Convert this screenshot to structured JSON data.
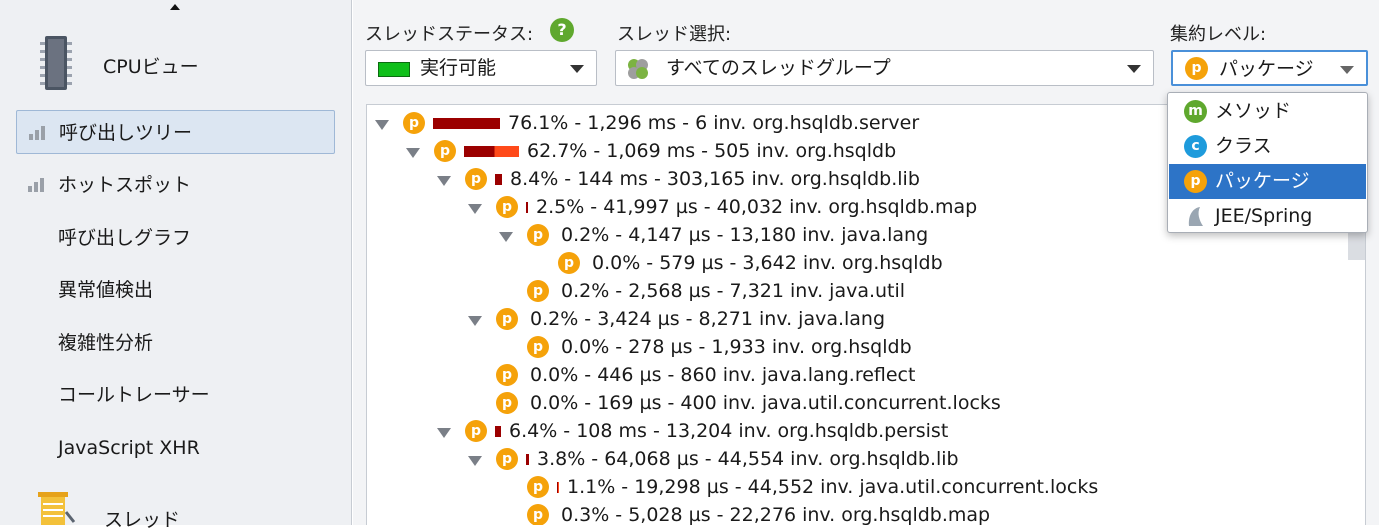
{
  "sidebar": {
    "cpu_view": "CPUビュー",
    "items": [
      {
        "label": "呼び出しツリー"
      },
      {
        "label": "ホットスポット"
      },
      {
        "label": "呼び出しグラフ"
      },
      {
        "label": "異常値検出"
      },
      {
        "label": "複雑性分析"
      },
      {
        "label": "コールトレーサー"
      },
      {
        "label": "JavaScript XHR"
      }
    ],
    "threads": "スレッド"
  },
  "toolbar": {
    "thread_status_label": "スレッドステータス:",
    "thread_status_value": "実行可能",
    "thread_select_label": "スレッド選択:",
    "thread_select_value": "すべてのスレッドグループ",
    "aggregation_label": "集約レベル:",
    "aggregation_value": "パッケージ",
    "package_badge": "p",
    "help_glyph": "?"
  },
  "dropdown": {
    "options": [
      {
        "label": "メソッド",
        "badge": "m",
        "color": "#5fa82e"
      },
      {
        "label": "クラス",
        "badge": "c",
        "color": "#1e9bdc"
      },
      {
        "label": "パッケージ",
        "badge": "p",
        "color": "#f5a20a"
      },
      {
        "label": "JEE/Spring",
        "badge": "",
        "color": "#9aa6b2"
      }
    ],
    "selected_index": 2
  },
  "tree": {
    "rows": [
      {
        "text": "76.1% - 1,296 ms - 6 inv. org.hsqldb.server",
        "depth": 0,
        "expanded": true,
        "hot": false,
        "pct": 76.1
      },
      {
        "text": "62.7% - 1,069 ms - 505 inv. org.hsqldb",
        "depth": 1,
        "expanded": true,
        "hot": true,
        "pct": 62.7
      },
      {
        "text": "8.4% - 144 ms - 303,165 inv. org.hsqldb.lib",
        "depth": 2,
        "expanded": true,
        "hot": false,
        "pct": 8.4
      },
      {
        "text": "2.5% - 41,997 µs - 40,032 inv. org.hsqldb.map",
        "depth": 3,
        "expanded": true,
        "hot": false,
        "pct": 2.5
      },
      {
        "text": "0.2% - 4,147 µs - 13,180 inv. java.lang",
        "depth": 4,
        "expanded": true,
        "hot": false,
        "pct": 0.2
      },
      {
        "text": "0.0% - 579 µs - 3,642 inv. org.hsqldb",
        "depth": 5,
        "expanded": null,
        "hot": true,
        "pct": 0.0
      },
      {
        "text": "0.2% - 2,568 µs - 7,321 inv. java.util",
        "depth": 4,
        "expanded": null,
        "hot": true,
        "pct": 0.2
      },
      {
        "text": "0.2% - 3,424 µs - 8,271 inv. java.lang",
        "depth": 3,
        "expanded": true,
        "hot": false,
        "pct": 0.2
      },
      {
        "text": "0.0% - 278 µs - 1,933 inv. org.hsqldb",
        "depth": 4,
        "expanded": null,
        "hot": true,
        "pct": 0.0
      },
      {
        "text": "0.0% - 446 µs - 860 inv. java.lang.reflect",
        "depth": 3,
        "expanded": null,
        "hot": true,
        "pct": 0.0
      },
      {
        "text": "0.0% - 169 µs - 400 inv. java.util.concurrent.locks",
        "depth": 3,
        "expanded": null,
        "hot": true,
        "pct": 0.0
      },
      {
        "text": "6.4% - 108 ms - 13,204 inv. org.hsqldb.persist",
        "depth": 2,
        "expanded": true,
        "hot": false,
        "pct": 6.4
      },
      {
        "text": "3.8% - 64,068 µs - 44,554 inv. org.hsqldb.lib",
        "depth": 3,
        "expanded": true,
        "hot": false,
        "pct": 3.8
      },
      {
        "text": "1.1% - 19,298 µs - 44,552 inv. java.util.concurrent.locks",
        "depth": 4,
        "expanded": null,
        "hot": true,
        "pct": 1.1
      },
      {
        "text": "0.3% - 5,028 µs - 22,276 inv. org.hsqldb.map",
        "depth": 4,
        "expanded": null,
        "hot": true,
        "pct": 0.3
      }
    ]
  }
}
